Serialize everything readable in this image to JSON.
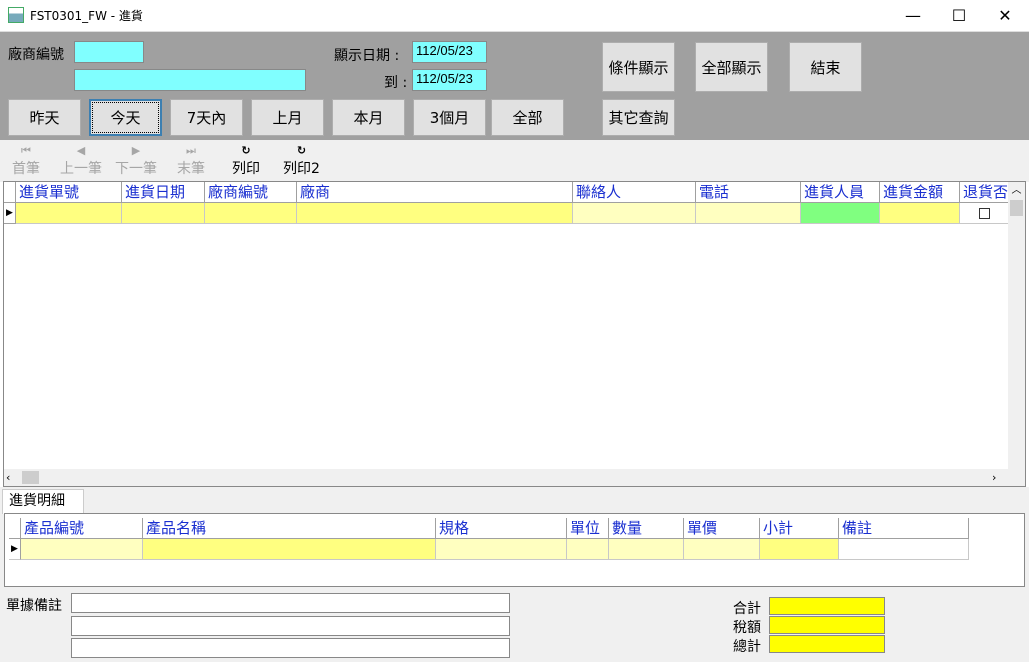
{
  "window": {
    "title": "FST0301_FW - 進貨",
    "controls": {
      "minimize": "—",
      "maximize": "☐",
      "close": "✕"
    }
  },
  "filter": {
    "vendor_code_label": "廠商編號",
    "vendor_code_value": "",
    "vendor_name_value": "",
    "date_label": "顯示日期 :",
    "date_from": "112/05/23",
    "date_to_label": "到 :",
    "date_to": "112/05/23",
    "buttons": {
      "condition": "條件顯示",
      "show_all": "全部顯示",
      "exit": "結束",
      "other_query": "其它查詢"
    },
    "range_buttons": [
      "昨天",
      "今天",
      "7天內",
      "上月",
      "本月",
      "3個月",
      "全部"
    ],
    "selected_range": "今天"
  },
  "nav": {
    "first": "首筆",
    "prev": "上一筆",
    "next": "下一筆",
    "last": "末筆",
    "print": "列印",
    "print2": "列印2"
  },
  "grid": {
    "columns": [
      "進貨單號",
      "進貨日期",
      "廠商編號",
      "廠商",
      "聯絡人",
      "電話",
      "進貨人員",
      "進貨金額",
      "退貨否"
    ]
  },
  "detail": {
    "tab_label": "進貨明細",
    "columns": [
      "產品編號",
      "產品名稱",
      "規格",
      "單位",
      "數量",
      "單價",
      "小計",
      "備註"
    ]
  },
  "footer": {
    "remark_label": "單據備註",
    "subtotal_label": "合計",
    "tax_label": "稅額",
    "total_label": "總計"
  },
  "colors": {
    "panel_gray": "#a0a0a0",
    "input_cyan": "#80ffff",
    "cell_yellow": "#ffff80",
    "cell_light_yellow": "#ffffc0",
    "cell_green": "#80ff80",
    "header_text_blue": "#1a2fd0",
    "total_yellow": "#ffff00"
  }
}
